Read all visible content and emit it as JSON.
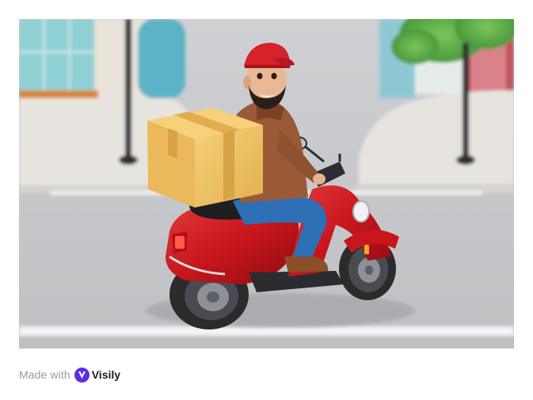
{
  "hero": {
    "image_subject": "delivery-scooter-illustration"
  },
  "footer": {
    "made_with_label": "Made with",
    "brand_name": "Visily",
    "brand_icon": "visily-logo-icon",
    "brand_color": "#5b2ee0"
  },
  "colors": {
    "scooter_red": "#c8161d",
    "box_yellow": "#f0c462",
    "jacket_brown": "#9a5a36",
    "cap_red": "#d6222b",
    "road_gray": "#c7c8cb"
  }
}
